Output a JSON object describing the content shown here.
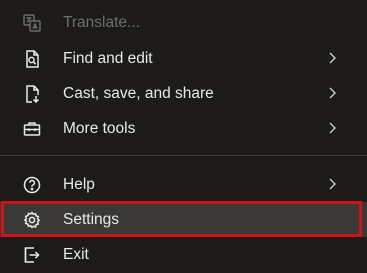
{
  "menu": {
    "items": [
      {
        "label": "Translate...",
        "icon": "translate-icon",
        "disabled": true,
        "submenu": false
      },
      {
        "label": "Find and edit",
        "icon": "find-page-icon",
        "disabled": false,
        "submenu": true
      },
      {
        "label": "Cast, save, and share",
        "icon": "save-page-icon",
        "disabled": false,
        "submenu": true
      },
      {
        "label": "More tools",
        "icon": "toolbox-icon",
        "disabled": false,
        "submenu": true
      },
      {
        "label": "Help",
        "icon": "help-icon",
        "disabled": false,
        "submenu": true
      },
      {
        "label": "Settings",
        "icon": "gear-icon",
        "disabled": false,
        "submenu": false,
        "highlighted": true
      },
      {
        "label": "Exit",
        "icon": "exit-icon",
        "disabled": false,
        "submenu": false
      }
    ],
    "highlight_color": "#d0121b",
    "background": "#1c1b18",
    "text_color": "#e9e9e7"
  }
}
